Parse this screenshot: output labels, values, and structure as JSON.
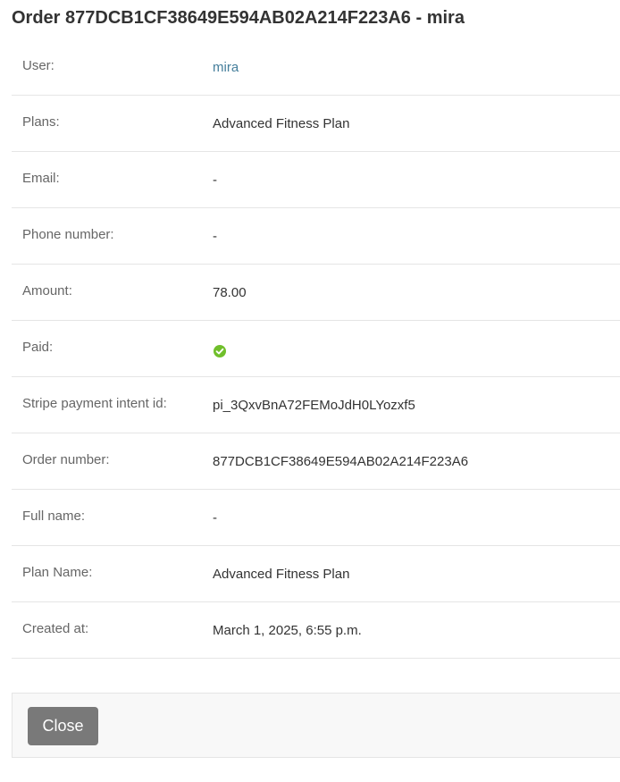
{
  "page": {
    "title": "Order 877DCB1CF38649E594AB02A214F223A6 - mira"
  },
  "details": {
    "rows": [
      {
        "label": "User:",
        "value": "mira"
      },
      {
        "label": "Plans:",
        "value": "Advanced Fitness Plan"
      },
      {
        "label": "Email:",
        "value": "-"
      },
      {
        "label": "Phone number:",
        "value": "-"
      },
      {
        "label": "Amount:",
        "value": "78.00"
      },
      {
        "label": "Paid:",
        "value": null,
        "icon": "check-circle-icon",
        "paid": true
      },
      {
        "label": "Stripe payment intent id:",
        "value": "pi_3QxvBnA72FEMoJdH0LYozxf5"
      },
      {
        "label": "Order number:",
        "value": "877DCB1CF38649E594AB02A214F223A6"
      },
      {
        "label": "Full name:",
        "value": "-"
      },
      {
        "label": "Plan Name:",
        "value": "Advanced Fitness Plan"
      },
      {
        "label": "Created at:",
        "value": "March 1, 2025, 6:55 p.m."
      }
    ]
  },
  "footer": {
    "close_label": "Close"
  },
  "colors": {
    "link": "#447e9b",
    "paid_icon": "#70bf2b",
    "button_bg": "#797979"
  }
}
